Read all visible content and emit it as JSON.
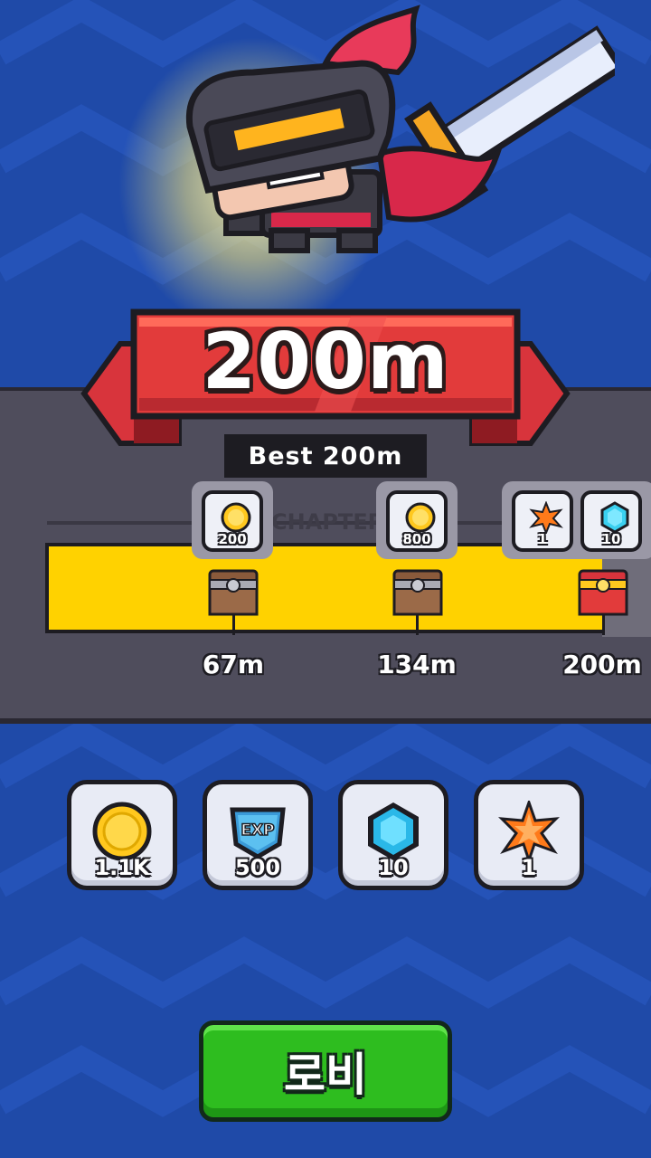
{
  "result": {
    "distance": "200m",
    "best": "Best 200m"
  },
  "progress": {
    "chapter_label": "CHAPTER",
    "milestones": [
      {
        "distance": "67m",
        "chest": "wooden-chest",
        "rewards": [
          {
            "icon": "coin-icon",
            "amount": "200"
          }
        ]
      },
      {
        "distance": "134m",
        "chest": "wooden-chest",
        "rewards": [
          {
            "icon": "coin-icon",
            "amount": "800"
          }
        ]
      },
      {
        "distance": "200m",
        "chest": "golden-chest",
        "rewards": [
          {
            "icon": "orange-star-gem-icon",
            "amount": "1"
          },
          {
            "icon": "blue-gem-icon",
            "amount": "10"
          }
        ]
      }
    ]
  },
  "earned": [
    {
      "icon": "coin-icon",
      "amount": "1.1K"
    },
    {
      "icon": "exp-badge-icon",
      "amount": "500",
      "badge_text": "EXP"
    },
    {
      "icon": "blue-gem-icon",
      "amount": "10"
    },
    {
      "icon": "orange-star-gem-icon",
      "amount": "1"
    }
  ],
  "lobby_button": "로비",
  "colors": {
    "background": "#1f4aa8",
    "ribbon": "#e23b3b",
    "track": "#ffd200",
    "button": "#2ebd1f"
  }
}
